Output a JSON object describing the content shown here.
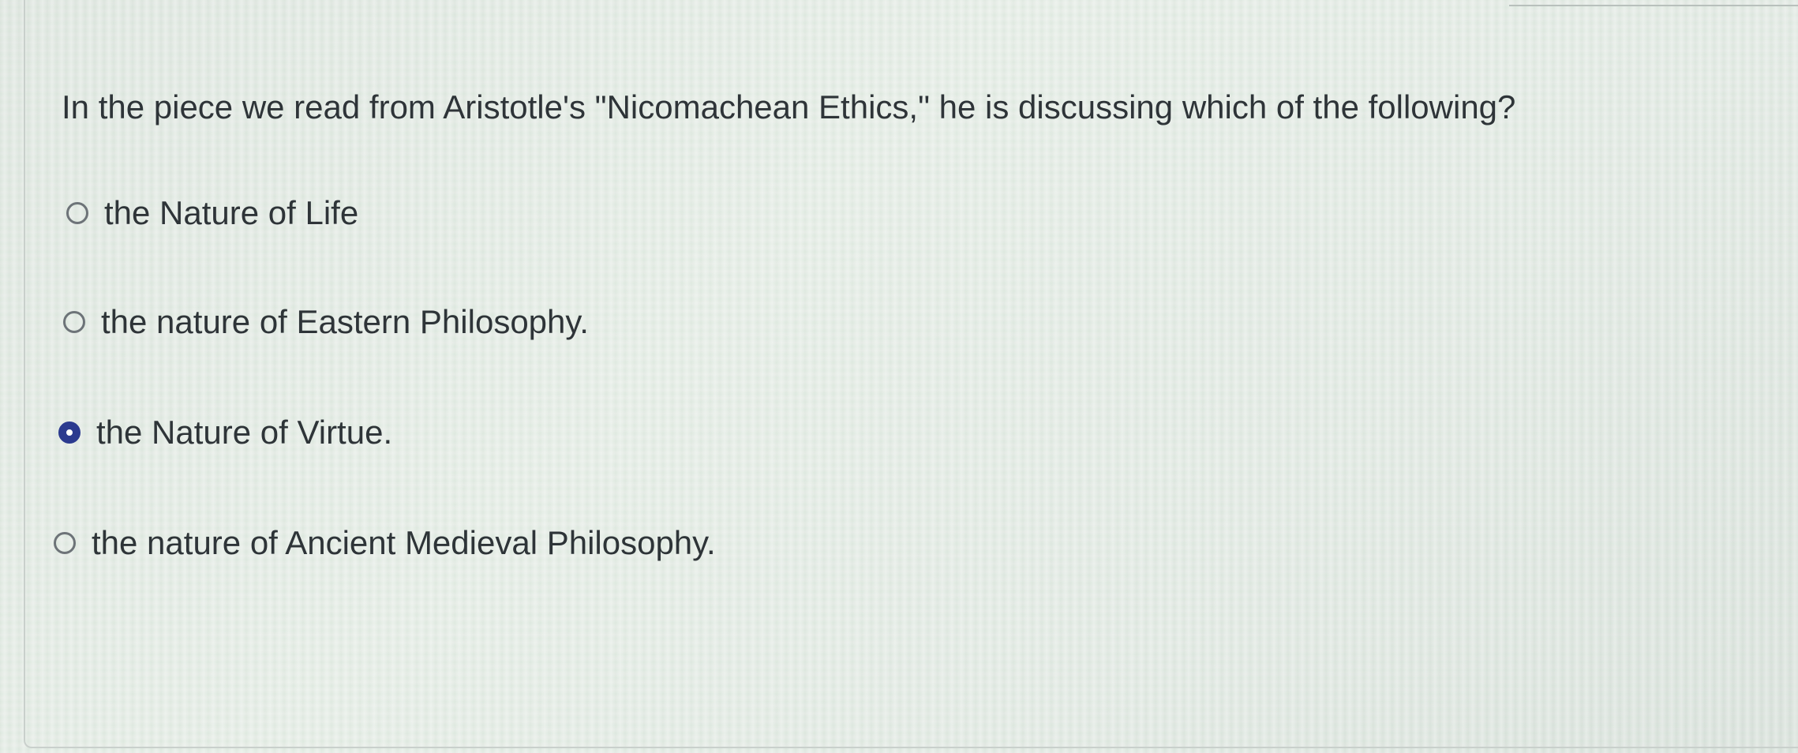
{
  "question": {
    "text": "In the piece we read from Aristotle's \"Nicomachean Ethics,\" he is discussing which of the following?"
  },
  "answers": [
    {
      "label": "the Nature of Life",
      "selected": false
    },
    {
      "label": "the nature of Eastern Philosophy.",
      "selected": false
    },
    {
      "label": "the Nature of Virtue.",
      "selected": true
    },
    {
      "label": "the nature of Ancient Medieval Philosophy.",
      "selected": false
    }
  ],
  "colors": {
    "selected_radio": "#2b3a8f",
    "text": "#2e3438"
  }
}
